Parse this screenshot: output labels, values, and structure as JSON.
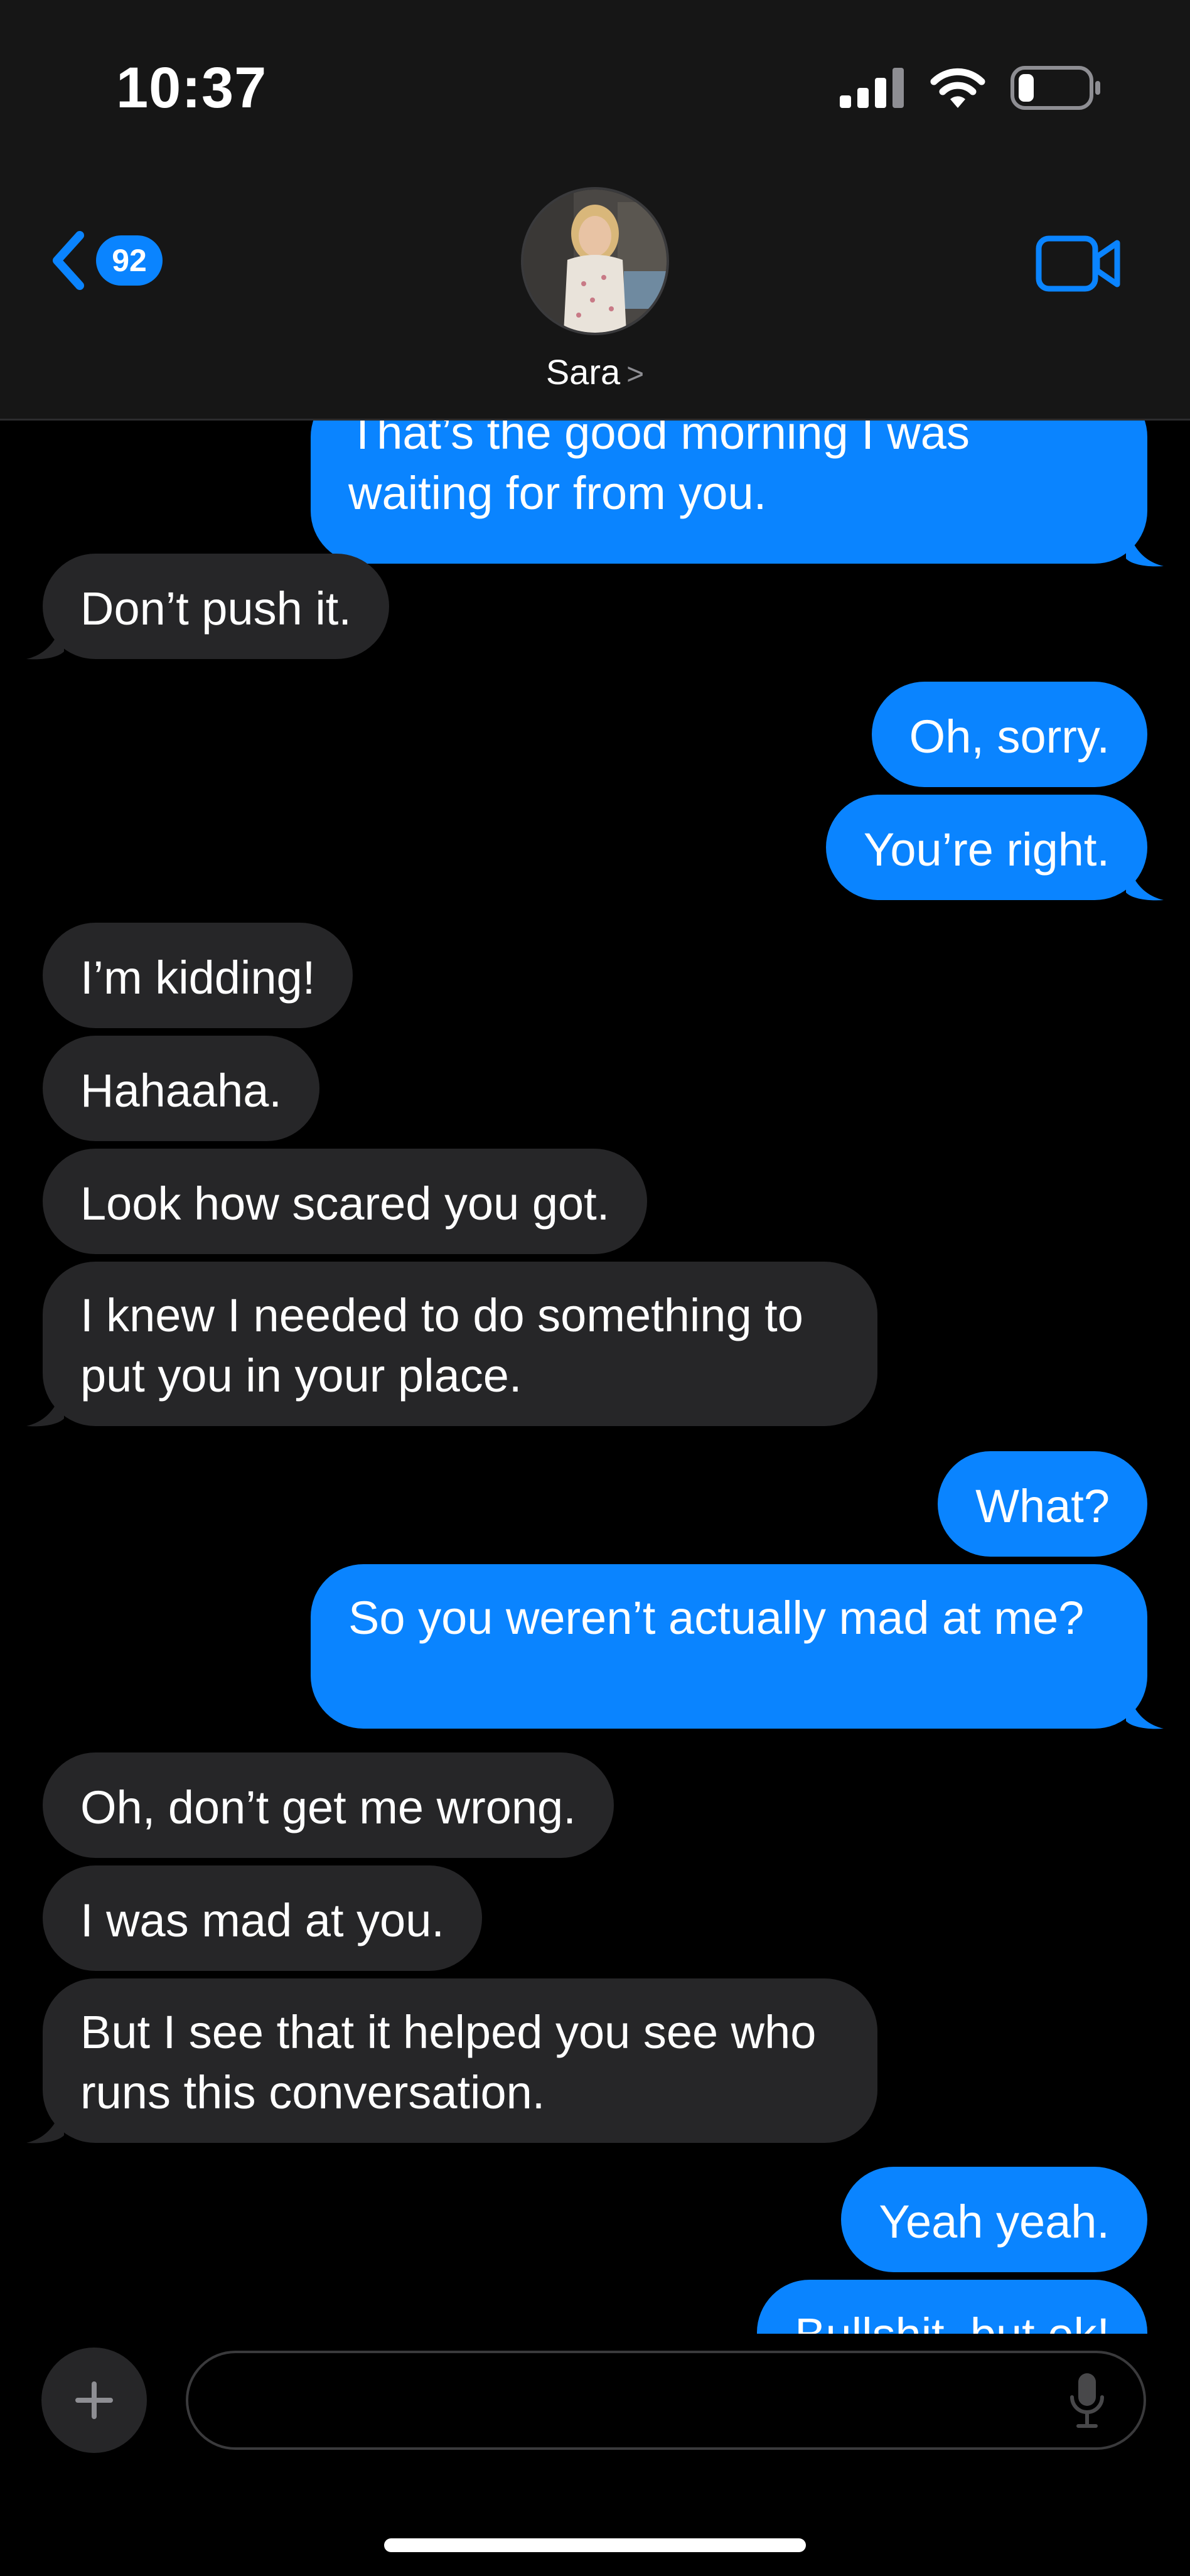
{
  "status_bar": {
    "time": "10:37"
  },
  "header": {
    "back_badge": "92",
    "contact_name": "Sara",
    "name_chevron": ">"
  },
  "messages": [
    {
      "from": "me",
      "text": "That’s the good morning I was waiting for from you."
    },
    {
      "from": "them",
      "text": "Don’t push it."
    },
    {
      "from": "me",
      "text": "Oh, sorry."
    },
    {
      "from": "me",
      "text": "You’re right."
    },
    {
      "from": "them",
      "text": "I’m kidding!"
    },
    {
      "from": "them",
      "text": "Hahaaha."
    },
    {
      "from": "them",
      "text": "Look how scared you got."
    },
    {
      "from": "them",
      "text": "I knew I needed to do something to put you in your place."
    },
    {
      "from": "me",
      "text": "What?"
    },
    {
      "from": "me",
      "text": "So you weren’t actually mad at me?"
    },
    {
      "from": "them",
      "text": "Oh, don’t get me wrong."
    },
    {
      "from": "them",
      "text": "I was mad at you."
    },
    {
      "from": "them",
      "text": "But I see that it helped you see who runs this conversation."
    },
    {
      "from": "me",
      "text": "Yeah yeah."
    },
    {
      "from": "me",
      "text": "Bullshit, but ok!"
    }
  ],
  "composer": {
    "placeholder": ""
  },
  "colors": {
    "outgoing": "#0a84ff",
    "incoming": "#262628",
    "background": "#000000",
    "header": "#161616"
  },
  "icons": [
    "back-chevron-icon",
    "video-camera-icon",
    "plus-icon",
    "microphone-icon",
    "cellular-signal-icon",
    "wifi-icon",
    "battery-icon"
  ]
}
